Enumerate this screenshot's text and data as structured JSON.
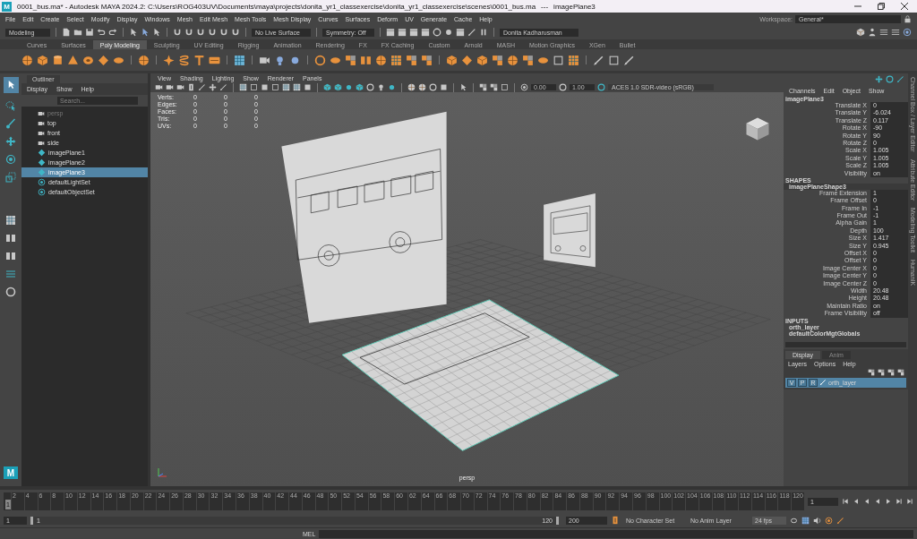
{
  "window": {
    "icon_letter": "M",
    "title": "0001_bus.ma* - Autodesk MAYA 2024.2: C:\\Users\\ROG403UV\\Documents\\maya\\projects\\donita_yr1_classexercise\\donita_yr1_classexercise\\scenes\\0001_bus.ma",
    "dots": "---",
    "selection": "imagePlane3"
  },
  "menu": [
    "File",
    "Edit",
    "Create",
    "Select",
    "Modify",
    "Display",
    "Windows",
    "Mesh",
    "Edit Mesh",
    "Mesh Tools",
    "Mesh Display",
    "Curves",
    "Surfaces",
    "Deform",
    "UV",
    "Generate",
    "Cache",
    "Help"
  ],
  "workspace": {
    "label": "Workspace:",
    "value": "General*"
  },
  "status_line": {
    "mode": "Modeling",
    "live_surface": "No Live Surface",
    "symmetry": "Symmetry: Off",
    "user": "Donita Kadharusman"
  },
  "shelf_tabs": [
    {
      "label": "Curves",
      "selected": false
    },
    {
      "label": "Surfaces",
      "selected": false
    },
    {
      "label": "Poly Modeling",
      "selected": true
    },
    {
      "label": "Sculpting",
      "selected": false
    },
    {
      "label": "UV Editing",
      "selected": false
    },
    {
      "label": "Rigging",
      "selected": false
    },
    {
      "label": "Animation",
      "selected": false
    },
    {
      "label": "Rendering",
      "selected": false
    },
    {
      "label": "FX",
      "selected": false
    },
    {
      "label": "FX Caching",
      "selected": false
    },
    {
      "label": "Custom",
      "selected": false
    },
    {
      "label": "Arnold",
      "selected": false
    },
    {
      "label": "MASH",
      "selected": false
    },
    {
      "label": "Motion Graphics",
      "selected": false
    },
    {
      "label": "XGen",
      "selected": false
    },
    {
      "label": "Bullet",
      "selected": false
    }
  ],
  "toolbox": {
    "logo": "M"
  },
  "outliner": {
    "title": "Outliner",
    "menu": [
      "Display",
      "Show",
      "Help"
    ],
    "search_placeholder": "Search...",
    "items": [
      {
        "label": "persp",
        "kind": "camera",
        "dimmed": true,
        "selected": false
      },
      {
        "label": "top",
        "kind": "camera",
        "dimmed": false,
        "selected": false
      },
      {
        "label": "front",
        "kind": "camera",
        "dimmed": false,
        "selected": false
      },
      {
        "label": "side",
        "kind": "camera",
        "dimmed": false,
        "selected": false
      },
      {
        "label": "imagePlane1",
        "kind": "image_plane",
        "dimmed": false,
        "selected": false
      },
      {
        "label": "imagePlane2",
        "kind": "image_plane",
        "dimmed": false,
        "selected": false
      },
      {
        "label": "imagePlane3",
        "kind": "image_plane",
        "dimmed": false,
        "selected": true
      },
      {
        "label": "defaultLightSet",
        "kind": "set",
        "dimmed": false,
        "selected": false
      },
      {
        "label": "defaultObjectSet",
        "kind": "set",
        "dimmed": false,
        "selected": false
      }
    ]
  },
  "viewport": {
    "menu": [
      "View",
      "Shading",
      "Lighting",
      "Show",
      "Renderer",
      "Panels"
    ],
    "exposure": "0.00",
    "gamma": "1.00",
    "color_space": "ACES 1.0 SDR-video (sRGB)",
    "camera": "persp",
    "stats": [
      {
        "label": "Verts:",
        "values": [
          "0",
          "0",
          "0"
        ]
      },
      {
        "label": "Edges:",
        "values": [
          "0",
          "0",
          "0"
        ]
      },
      {
        "label": "Faces:",
        "values": [
          "0",
          "0",
          "0"
        ]
      },
      {
        "label": "Tris:",
        "values": [
          "0",
          "0",
          "0"
        ]
      },
      {
        "label": "UVs:",
        "values": [
          "0",
          "0",
          "0"
        ]
      }
    ]
  },
  "channel_box": {
    "menu": [
      "Channels",
      "Edit",
      "Object",
      "Show"
    ],
    "object": "imagePlane3",
    "channels": [
      {
        "name": "Translate X",
        "value": "0"
      },
      {
        "name": "Translate Y",
        "value": "-6.024"
      },
      {
        "name": "Translate Z",
        "value": "0.117"
      },
      {
        "name": "Rotate X",
        "value": "-90"
      },
      {
        "name": "Rotate Y",
        "value": "90"
      },
      {
        "name": "Rotate Z",
        "value": "0"
      },
      {
        "name": "Scale X",
        "value": "1.005"
      },
      {
        "name": "Scale Y",
        "value": "1.005"
      },
      {
        "name": "Scale Z",
        "value": "1.005"
      },
      {
        "name": "Visibility",
        "value": "on"
      }
    ],
    "shapes_heading": "SHAPES",
    "shape": "imagePlaneShape3",
    "shape_channels": [
      {
        "name": "Frame Extension",
        "value": "1"
      },
      {
        "name": "Frame Offset",
        "value": "0"
      },
      {
        "name": "Frame In",
        "value": "-1"
      },
      {
        "name": "Frame Out",
        "value": "-1"
      },
      {
        "name": "Alpha Gain",
        "value": "1"
      },
      {
        "name": "Depth",
        "value": "100"
      },
      {
        "name": "Size X",
        "value": "1.417"
      },
      {
        "name": "Size Y",
        "value": "0.945"
      },
      {
        "name": "Offset X",
        "value": "0"
      },
      {
        "name": "Offset Y",
        "value": "0"
      },
      {
        "name": "Image Center X",
        "value": "0"
      },
      {
        "name": "Image Center Y",
        "value": "0"
      },
      {
        "name": "Image Center Z",
        "value": "0"
      },
      {
        "name": "Width",
        "value": "20.48"
      },
      {
        "name": "Height",
        "value": "20.48"
      },
      {
        "name": "Maintain Ratio",
        "value": "on"
      },
      {
        "name": "Frame Visibility",
        "value": "off"
      }
    ],
    "inputs_heading": "INPUTS",
    "inputs": [
      "orth_layer",
      "defaultColorMgtGlobals"
    ]
  },
  "side_tabs": [
    "Channel Box / Layer Editor",
    "Attribute Editor",
    "Modeling Toolkit",
    "HumanIK"
  ],
  "layer_editor": {
    "tabs": [
      {
        "label": "Display",
        "selected": true
      },
      {
        "label": "Anim",
        "selected": false
      }
    ],
    "menu": [
      "Layers",
      "Options",
      "Help"
    ],
    "layers": [
      {
        "name": "orth_layer",
        "buttons": [
          "V",
          "P",
          "R"
        ],
        "selected": true
      }
    ]
  },
  "time_slider": {
    "level": 0,
    "ticks": [
      "2",
      "4",
      "6",
      "8",
      "10",
      "12",
      "14",
      "16",
      "18",
      "20",
      "22",
      "24",
      "26",
      "28",
      "30",
      "32",
      "34",
      "36",
      "38",
      "40",
      "42",
      "44",
      "46",
      "48",
      "50",
      "52",
      "54",
      "56",
      "58",
      "60",
      "62",
      "64",
      "66",
      "68",
      "70",
      "72",
      "74",
      "76",
      "78",
      "80",
      "82",
      "84",
      "86",
      "88",
      "90",
      "92",
      "94",
      "96",
      "98",
      "100",
      "102",
      "104",
      "106",
      "108",
      "110",
      "112",
      "114",
      "116",
      "118",
      "120"
    ],
    "current_frame": "1",
    "frame_field": "1"
  },
  "range_slider": {
    "start": "1",
    "range_start": "1",
    "range_end": "120",
    "end": "200",
    "character_set": "No Character Set",
    "anim_layer": "No Anim Layer",
    "fps": "24 fps"
  },
  "command_line": {
    "language": "MEL"
  }
}
